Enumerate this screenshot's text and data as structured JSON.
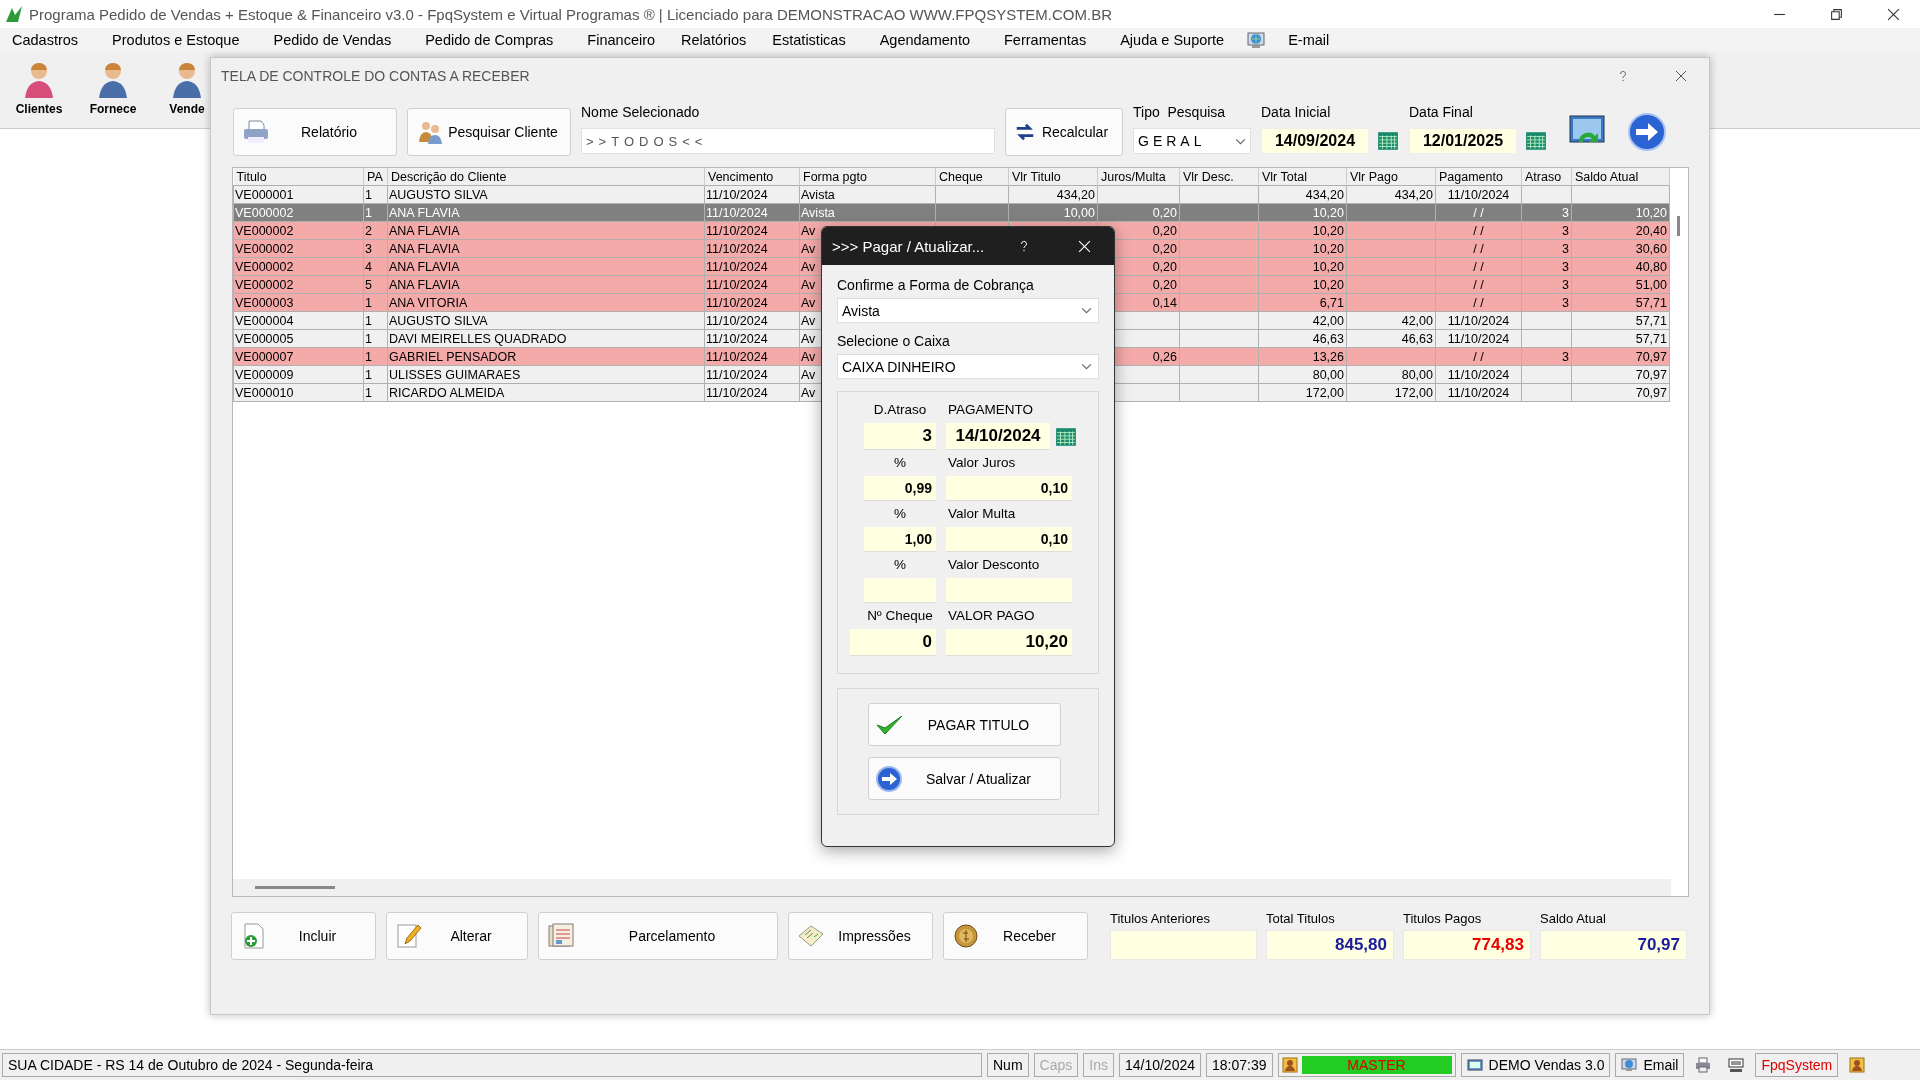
{
  "window": {
    "title": "Programa Pedido de Vendas + Estoque & Financeiro v3.0 - FpqSystem e Virtual Programas ® | Licenciado para  DEMONSTRACAO WWW.FPQSYSTEM.COM.BR"
  },
  "menu": [
    {
      "kind": "text",
      "label": "Cadastros"
    },
    {
      "kind": "text",
      "label": "Produtos e Estoque"
    },
    {
      "kind": "text",
      "label": "Pedido de Vendas"
    },
    {
      "kind": "text",
      "label": "Pedido de Compras"
    },
    {
      "kind": "text",
      "label": "Financeiro"
    },
    {
      "kind": "text",
      "label": "Relatórios"
    },
    {
      "kind": "text",
      "label": "Estatisticas"
    },
    {
      "kind": "text",
      "label": "Agendamento"
    },
    {
      "kind": "text",
      "label": "Ferramentas"
    },
    {
      "kind": "text",
      "label": "Ajuda e Suporte"
    },
    {
      "kind": "icon"
    },
    {
      "kind": "text",
      "label": "E-mail"
    }
  ],
  "toolbar": [
    {
      "label": "Clientes"
    },
    {
      "label": "Fornece"
    },
    {
      "label": "Vende"
    }
  ],
  "form": {
    "title": "TELA DE CONTROLE DO CONTAS A RECEBER",
    "top_buttons": [
      {
        "kind": "print",
        "label": "Relatório"
      },
      {
        "kind": "search",
        "label": "Pesquisar Cliente"
      }
    ],
    "nome_selecionado": {
      "label": "Nome Selecionado",
      "value": ">>TODOS<<"
    },
    "recalcular": {
      "label": "Recalcular"
    },
    "tipo_pesquisa": {
      "label": "Tipo  Pesquisa",
      "value": "GERAL"
    },
    "data_inicial": {
      "label": "Data Inicial",
      "value": "14/09/2024"
    },
    "data_final": {
      "label": "Data Final",
      "value": "12/01/2025"
    },
    "table": {
      "columns": [
        {
          "label": "Titulo"
        },
        {
          "label": "PA"
        },
        {
          "label": "Descrição do Cliente"
        },
        {
          "label": "Vencimento"
        },
        {
          "label": "Forma pgto"
        },
        {
          "label": "Cheque"
        },
        {
          "label": "Vlr Titulo"
        },
        {
          "label": "Juros/Multa"
        },
        {
          "label": "Vlr Desc."
        },
        {
          "label": "Vlr Total"
        },
        {
          "label": "Vlr Pago"
        },
        {
          "label": "Pagamento"
        },
        {
          "label": "Atraso"
        },
        {
          "label": "Saldo Atual"
        }
      ],
      "rows": [
        {
          "selected": false,
          "overdue": false,
          "titulo": "VE000001",
          "pa": "1",
          "cliente": "AUGUSTO SILVA",
          "vencimento": "11/10/2024",
          "forma": "Avista",
          "vlr_titulo": "434,20",
          "vlr_total": "434,20",
          "vlr_pago": "434,20",
          "pagamento": "11/10/2024"
        },
        {
          "selected": true,
          "overdue": true,
          "titulo": "VE000002",
          "pa": "1",
          "cliente": "ANA FLAVIA",
          "vencimento": "11/10/2024",
          "forma": "Avista",
          "vlr_titulo": "10,00",
          "juros": "0,20",
          "vlr_total": "10,20",
          "pagamento": "/ /",
          "atraso": "3",
          "saldo": "10,20"
        },
        {
          "selected": false,
          "overdue": true,
          "titulo": "VE000002",
          "pa": "2",
          "cliente": "ANA FLAVIA",
          "vencimento": "11/10/2024",
          "forma": "Av",
          "juros": "0,20",
          "vlr_total": "10,20",
          "pagamento": "/ /",
          "atraso": "3",
          "saldo": "20,40"
        },
        {
          "selected": false,
          "overdue": true,
          "titulo": "VE000002",
          "pa": "3",
          "cliente": "ANA FLAVIA",
          "vencimento": "11/10/2024",
          "forma": "Av",
          "juros": "0,20",
          "vlr_total": "10,20",
          "pagamento": "/ /",
          "atraso": "3",
          "saldo": "30,60"
        },
        {
          "selected": false,
          "overdue": true,
          "titulo": "VE000002",
          "pa": "4",
          "cliente": "ANA FLAVIA",
          "vencimento": "11/10/2024",
          "forma": "Av",
          "juros": "0,20",
          "vlr_total": "10,20",
          "pagamento": "/ /",
          "atraso": "3",
          "saldo": "40,80"
        },
        {
          "selected": false,
          "overdue": true,
          "titulo": "VE000002",
          "pa": "5",
          "cliente": "ANA FLAVIA",
          "vencimento": "11/10/2024",
          "forma": "Av",
          "juros": "0,20",
          "vlr_total": "10,20",
          "pagamento": "/ /",
          "atraso": "3",
          "saldo": "51,00"
        },
        {
          "selected": false,
          "overdue": true,
          "titulo": "VE000003",
          "pa": "1",
          "cliente": "ANA VITORIA",
          "vencimento": "11/10/2024",
          "forma": "Av",
          "juros": "0,14",
          "vlr_total": "6,71",
          "pagamento": "/ /",
          "atraso": "3",
          "saldo": "57,71"
        },
        {
          "selected": false,
          "overdue": false,
          "titulo": "VE000004",
          "pa": "1",
          "cliente": "AUGUSTO SILVA",
          "vencimento": "11/10/2024",
          "forma": "Av",
          "vlr_total": "42,00",
          "vlr_pago": "42,00",
          "pagamento": "11/10/2024",
          "saldo": "57,71"
        },
        {
          "selected": false,
          "overdue": false,
          "titulo": "VE000005",
          "pa": "1",
          "cliente": "DAVI MEIRELLES QUADRADO",
          "vencimento": "11/10/2024",
          "forma": "Av",
          "vlr_total": "46,63",
          "vlr_pago": "46,63",
          "pagamento": "11/10/2024",
          "saldo": "57,71"
        },
        {
          "selected": false,
          "overdue": true,
          "titulo": "VE000007",
          "pa": "1",
          "cliente": "GABRIEL PENSADOR",
          "vencimento": "11/10/2024",
          "forma": "Av",
          "juros": "0,26",
          "vlr_total": "13,26",
          "pagamento": "/ /",
          "atraso": "3",
          "saldo": "70,97"
        },
        {
          "selected": false,
          "overdue": false,
          "titulo": "VE000009",
          "pa": "1",
          "cliente": "ULISSES GUIMARAES",
          "vencimento": "11/10/2024",
          "forma": "Av",
          "vlr_total": "80,00",
          "vlr_pago": "80,00",
          "pagamento": "11/10/2024",
          "saldo": "70,97"
        },
        {
          "selected": false,
          "overdue": false,
          "titulo": "VE000010",
          "pa": "1",
          "cliente": "RICARDO ALMEIDA",
          "vencimento": "11/10/2024",
          "forma": "Av",
          "vlr_total": "172,00",
          "vlr_pago": "172,00",
          "pagamento": "11/10/2024",
          "saldo": "70,97"
        }
      ]
    },
    "bottom_buttons": [
      {
        "kind": "add",
        "label": "Incluir"
      },
      {
        "kind": "edit",
        "label": "Alterar"
      },
      {
        "kind": "installments",
        "label": "Parcelamento"
      },
      {
        "kind": "print",
        "label": "Impressões"
      },
      {
        "kind": "receive",
        "label": "Receber"
      }
    ],
    "totals": [
      {
        "label": "Titulos Anteriores"
      },
      {
        "label": "Total Titulos",
        "value": "845,80",
        "color": "#1c1c9e"
      },
      {
        "label": "Titulos Pagos",
        "value": "774,83",
        "color": "#e60000"
      },
      {
        "label": "Saldo Atual",
        "value": "70,97",
        "color": "#1c1c9e"
      }
    ]
  },
  "dialog": {
    "title": ">>> Pagar / Atualizar...",
    "forma": {
      "label": "Confirme a Forma de Cobrança",
      "value": "Avista"
    },
    "caixa": {
      "label": "Selecione o Caixa",
      "value": "CAIXA DINHEIRO"
    },
    "rows": [
      {
        "left": {
          "label": "D.Atraso",
          "value": "3"
        },
        "right": {
          "label": "PAGAMENTO",
          "value": "14/10/2024"
        }
      },
      {
        "left": {
          "label": "%",
          "value": "0,99"
        },
        "right": {
          "label": "Valor Juros",
          "value": "0,10"
        }
      },
      {
        "left": {
          "label": "%",
          "value": "1,00"
        },
        "right": {
          "label": "Valor Multa",
          "value": "0,10"
        }
      },
      {
        "left": {
          "label": "%"
        },
        "right": {
          "label": "Valor Desconto"
        }
      },
      {
        "left": {
          "label": "Nº Cheque",
          "value": "0"
        },
        "right": {
          "label": "VALOR PAGO",
          "value": "10,20"
        }
      }
    ],
    "buttons": [
      {
        "kind": "confirm",
        "label": "PAGAR TITULO"
      },
      {
        "kind": "save",
        "label": "Salvar / Atualizar"
      }
    ]
  },
  "status_bar": [
    {
      "kind": "text",
      "text": "SUA CIDADE - RS 14 de Outubro de 2024 - Segunda-feira",
      "disabled": false
    },
    {
      "kind": "text",
      "text": "Num",
      "disabled": false
    },
    {
      "kind": "text",
      "text": "Caps",
      "disabled": true
    },
    {
      "kind": "text",
      "text": "Ins",
      "disabled": true
    },
    {
      "kind": "text",
      "text": "14/10/2024",
      "disabled": false
    },
    {
      "kind": "text",
      "text": "18:07:39",
      "disabled": false
    },
    {
      "kind": "user",
      "text": "MASTER"
    },
    {
      "kind": "app",
      "text": "DEMO Vendas 3.0"
    },
    {
      "kind": "email",
      "text": "Email"
    },
    {
      "kind": "printer"
    },
    {
      "kind": "monitor"
    },
    {
      "kind": "brand",
      "text": "FpqSystem"
    },
    {
      "kind": "badge"
    }
  ]
}
